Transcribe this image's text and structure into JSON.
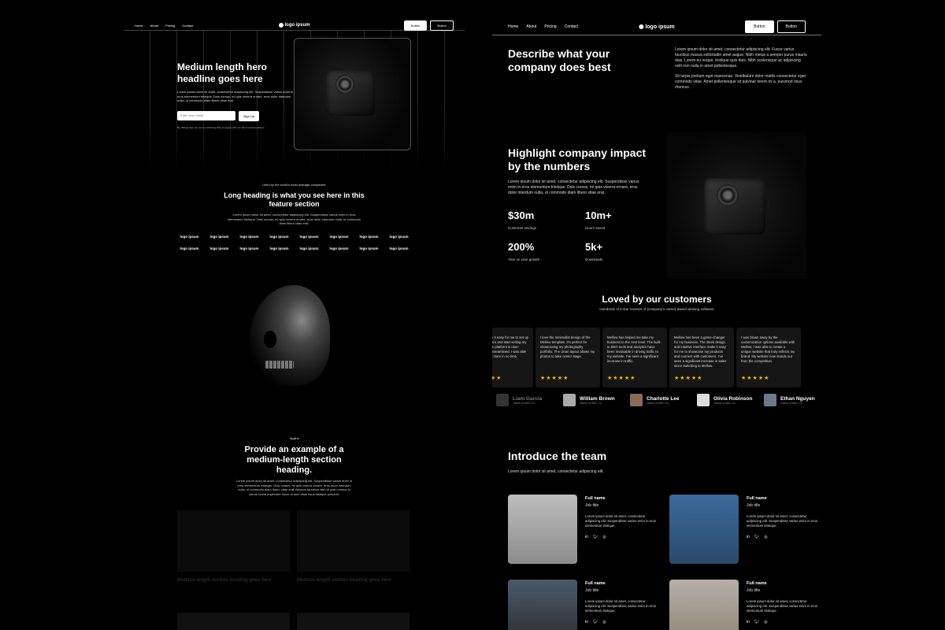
{
  "nav": {
    "links": [
      "Home",
      "About",
      "Pricing",
      "Contact"
    ],
    "logo": "logo ipsum",
    "button_primary": "Button",
    "button_secondary": "Button"
  },
  "left": {
    "hero": {
      "headline": "Medium length hero headline goes here",
      "body": "Lorem ipsum dolor sit amet, consectetur adipiscing elit. Suspendisse varius enim in eros elementum tristique. Duis cursus, mi quis viverra ornare, eros dolor interdum nulla, ut commodo diam libero vitae erat.",
      "email_placeholder": "Enter your email",
      "signup_button": "Sign Up",
      "terms": "By clicking Sign Up you're confirming that you agree with our Terms and Conditions."
    },
    "logos_section": {
      "kicker": "Used by the world's most average companies",
      "heading": "Long heading is what you see here in this feature section",
      "body": "Lorem ipsum dolor sit amet, consectetur adipiscing elit. Suspendisse varius enim in eros elementum tristique. Duis cursus, mi quis viverra ornare, eros dolor interdum nulla, ut commodo diam libero vitae erat.",
      "logo_label": "logo ipsum"
    },
    "section2": {
      "tagline": "Tagline",
      "heading": "Provide an example of a medium-length section heading.",
      "body": "Lorem ipsum dolor sit amet, consectetur adipiscing elit. Suspendisse varius enim in eros elementum tristique. Duis cursus, mi quis viverra ornare, eros dolor interdum nulla, ut commodo diam libero vitae erat. Aenean faucibus nibh et justo cursus id rutrum lorem imperdiet. Nunc ut sem vitae risus tristique posuere.",
      "card_heading_1": "Medium length section heading goes here",
      "card_heading_2": "Medium length section heading goes here"
    }
  },
  "right": {
    "describe": {
      "heading": "Describe what your company does best",
      "p1": "Lorem ipsum dolor sit amet, consectetur adipiscing elit. Fusce varius faucibus massa sollicitudin amet augue. Nibh metus a semper purus mauris duis. Lorem eu neque, tristique quis duis. Nibh scelerisque ac adipiscing velit non nulla in amet pellentesque.",
      "p2": "Sit turpis pretium eget maecenas. Vestibulum dolor mattis consectetur eget commodo vitae. Amet pellentesque sit pulvinar lorem mi a, euismod risus rhoncus."
    },
    "impact": {
      "heading": "Highlight company impact by the numbers",
      "body": "Lorem ipsum dolor sit amet, consectetur adipiscing elit. Suspendisse varius enim in eros elementum tristique. Duis cursus, mi quis viverra ornare, eros dolor interdum nulla, ut commodo diam libero vitae erat.",
      "stats": [
        {
          "value": "$30m",
          "label": "Customer savings"
        },
        {
          "value": "10m+",
          "label": "Hours saved"
        },
        {
          "value": "200%",
          "label": "Year on year growth"
        },
        {
          "value": "5k+",
          "label": "Downloads"
        }
      ]
    },
    "testimonials": {
      "heading": "Loved by our customers",
      "sub": "Hundreds of 5-star reviews of {company's name} award winning software",
      "cards": [
        "Mellow made it easy for me to set up my online store and start selling my products. The platform is user-friendly and streamlined. I was able to launch my store in no time.",
        "I love the minimalist design of the Mellow template. It's perfect for showcasing my photography portfolio. The clean layout allows my photos to take center stage.",
        "Mellow has helped me take my business to the next level. The built-in SEO tools and analytics have been invaluable in driving traffic to my website. I've seen a significant increase in traffic.",
        "Mellow has been a game-changer for my business. The sleek design and intuitive interface make it easy for me to showcase my products and connect with customers. I've seen a significant increase in sales since switching to Mellow.",
        "I was blown away by the customization options available with Mellow. I was able to create a unique website that truly reflects my brand. My website now stands out from the competition."
      ],
      "stars": "★★★★★",
      "people": [
        {
          "name": "Liam Garcia",
          "role": "Owner of ABC Co."
        },
        {
          "name": "William Brown",
          "role": "Owner of ABC Co."
        },
        {
          "name": "Charlotte Lee",
          "role": "Owner of ABC Co."
        },
        {
          "name": "Olivia Robinson",
          "role": "Owner of ABC Co."
        },
        {
          "name": "Ethan Nguyen",
          "role": "Owner of ABC Co."
        }
      ]
    },
    "team": {
      "heading": "Introduce the team",
      "sub": "Lorem ipsum dolor sit amet, consectetur adipiscing elit.",
      "member_name": "Full name",
      "member_job": "Job title",
      "member_bio": "Lorem ipsum dolor sit amet, consectetur adipiscing elit. Suspendisse varius enim in eros elementum tristique."
    }
  },
  "colors": {
    "background": "#000000",
    "accent_star": "#f5b800"
  }
}
